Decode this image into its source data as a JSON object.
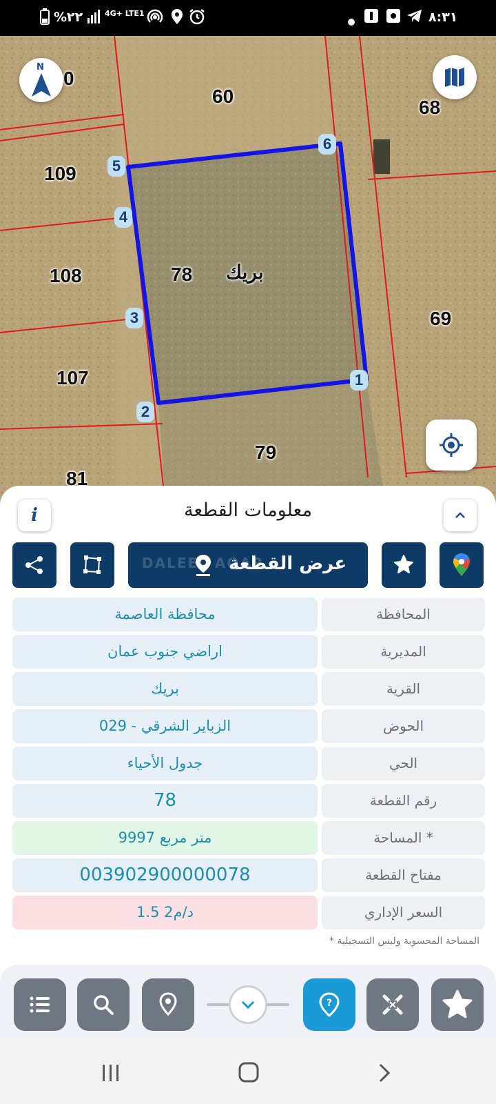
{
  "status_bar": {
    "time": "٨:٣١",
    "battery": "%٢٢",
    "network": "4G+ LTE1"
  },
  "map": {
    "parcel_labels": [
      "0",
      "60",
      "68",
      "109",
      "108",
      "78",
      "69",
      "107",
      "79",
      "81"
    ],
    "village_label": "بريك",
    "vertices": [
      "1",
      "2",
      "3",
      "4",
      "5",
      "6"
    ],
    "compass_letter": "N",
    "boundary_color": "#1414e6",
    "lines_color": "#e0191e"
  },
  "panel": {
    "title": "معلومات القطعة",
    "view_button": "عرض القطعة",
    "watermark": "DALEEL AQAR",
    "rows": [
      {
        "label": "المحافظة",
        "value": "محافظة العاصمة"
      },
      {
        "label": "المديرية",
        "value": "اراضي جنوب عمان"
      },
      {
        "label": "القرية",
        "value": "بريك"
      },
      {
        "label": "الحوض",
        "value": "الزباير الشرقي - 029"
      },
      {
        "label": "الحي",
        "value": "جدول الأحياء"
      },
      {
        "label": "رقم القطعة",
        "value": "78"
      },
      {
        "label": "المساحة *",
        "value": "9997  متر مربع"
      },
      {
        "label": "مفتاح القطعة",
        "value": "003902900000078"
      },
      {
        "label": "السعر الإداري",
        "value": "1.5 د/م2"
      }
    ],
    "footnote": "* المساحة المحسوبة وليس التسجيلية"
  },
  "colors": {
    "primary": "#0e3a66",
    "accent": "#1a9bd7",
    "value_text": "#1a8fb0"
  }
}
